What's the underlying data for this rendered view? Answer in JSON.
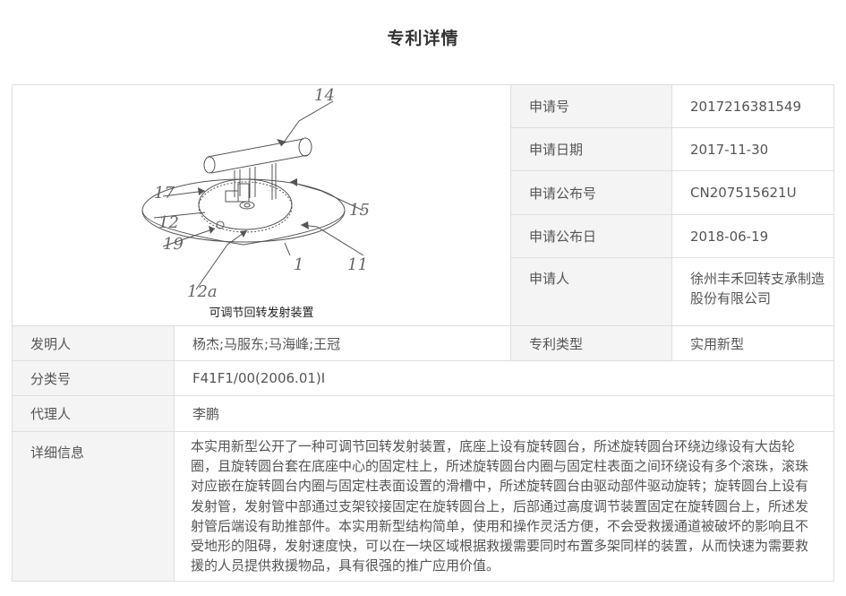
{
  "page_title": "专利详情",
  "figure": {
    "caption": "可调节回转发射装置",
    "labels": [
      "14",
      "17",
      "15",
      "12",
      "19",
      "1",
      "11",
      "12a"
    ]
  },
  "fields": {
    "application_number": {
      "label": "申请号",
      "value": "2017216381549"
    },
    "application_date": {
      "label": "申请日期",
      "value": "2017-11-30"
    },
    "publication_number": {
      "label": "申请公布号",
      "value": "CN207515621U"
    },
    "publication_date": {
      "label": "申请公布日",
      "value": "2018-06-19"
    },
    "applicant": {
      "label": "申请人",
      "value": "徐州丰禾回转支承制造股份有限公司"
    },
    "inventors": {
      "label": "发明人",
      "value": "杨杰;马服东;马海峰;王冠"
    },
    "patent_type": {
      "label": "专利类型",
      "value": "实用新型"
    },
    "classification": {
      "label": "分类号",
      "value": "F41F1/00(2006.01)I"
    },
    "agent": {
      "label": "代理人",
      "value": "李鹏"
    },
    "details": {
      "label": "详细信息",
      "value": "本实用新型公开了一种可调节回转发射装置，底座上设有旋转圆台，所述旋转圆台环绕边缘设有大齿轮圈，且旋转圆台套在底座中心的固定柱上，所述旋转圆台内圈与固定柱表面之间环绕设有多个滚珠，滚珠对应嵌在旋转圆台内圈与固定柱表面设置的滑槽中，所述旋转圆台由驱动部件驱动旋转；旋转圆台上设有发射管，发射管中部通过支架铰接固定在旋转圆台上，后部通过高度调节装置固定在旋转圆台上，所述发射管后端设有助推部件。本实用新型结构简单，使用和操作灵活方便，不会受救援通道被破坏的影响且不受地形的阻碍，发射速度快，可以在一块区域根据救援需要同时布置多架同样的装置，从而快速为需要救援的人员提供救援物品，具有很强的推广应用价值。"
    }
  }
}
